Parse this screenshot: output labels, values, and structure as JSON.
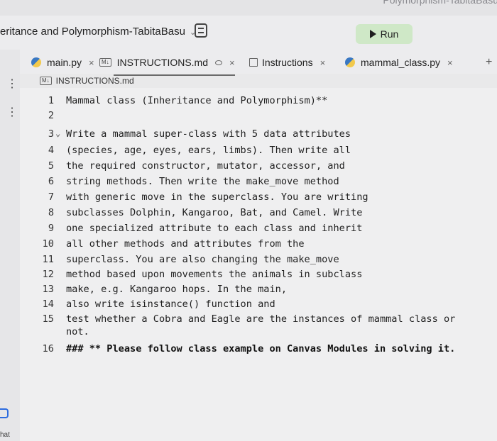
{
  "window": {
    "breadcrumb": "Polymorphism-TabitaBasu"
  },
  "header": {
    "repl_name": "eritance and Polymorphism-TabitaBasu",
    "run_label": "Run"
  },
  "tabs": [
    {
      "label": "main.py",
      "icon": "python-file-icon"
    },
    {
      "label": "INSTRUCTIONS.md",
      "icon": "markdown-file-icon"
    },
    {
      "label": "Instructions",
      "icon": "book-icon"
    },
    {
      "label": "mammal_class.py",
      "icon": "python-file-icon"
    }
  ],
  "tab_close": "×",
  "tab_add": "+",
  "file_path": "INSTRUCTIONS.md",
  "md_badge": "M↓",
  "left_rail": {
    "chat_label": "hat"
  },
  "editor_lines": [
    {
      "n": "1",
      "text": "Mammal class (Inheritance and Polymorphism)**"
    },
    {
      "n": "2",
      "text": ""
    },
    {
      "n": "3",
      "text": "Write a mammal super-class with 5 data attributes"
    },
    {
      "n": "4",
      "text": "(species, age, eyes, ears, limbs). Then write all"
    },
    {
      "n": "5",
      "text": "the required constructor, mutator, accessor, and"
    },
    {
      "n": "6",
      "text": "string methods. Then write the make_move method"
    },
    {
      "n": "7",
      "text": "with generic move in the superclass. You are writing"
    },
    {
      "n": "8",
      "text": "subclasses Dolphin, Kangaroo, Bat, and Camel. Write"
    },
    {
      "n": "9",
      "text": "one specialized attribute to each class and inherit"
    },
    {
      "n": "10",
      "text": "all other methods and attributes from the"
    },
    {
      "n": "11",
      "text": "superclass. You are also changing the make_move"
    },
    {
      "n": "12",
      "text": "method based upon movements the animals in subclass"
    },
    {
      "n": "13",
      "text": "make, e.g. Kangaroo hops. In the main,"
    },
    {
      "n": "14",
      "text": "also write isinstance() function and"
    },
    {
      "n": "15",
      "text": "test whether a Cobra and Eagle are the instances of mammal class or"
    },
    {
      "n": "",
      "text": "not."
    },
    {
      "n": "16",
      "text": "### ** Please follow class example on Canvas Modules in solving it."
    }
  ],
  "colors": {
    "run_bg": "#cfe8c7",
    "editor_bg": "#efeff0",
    "rail_accent": "#2d6cdf"
  }
}
